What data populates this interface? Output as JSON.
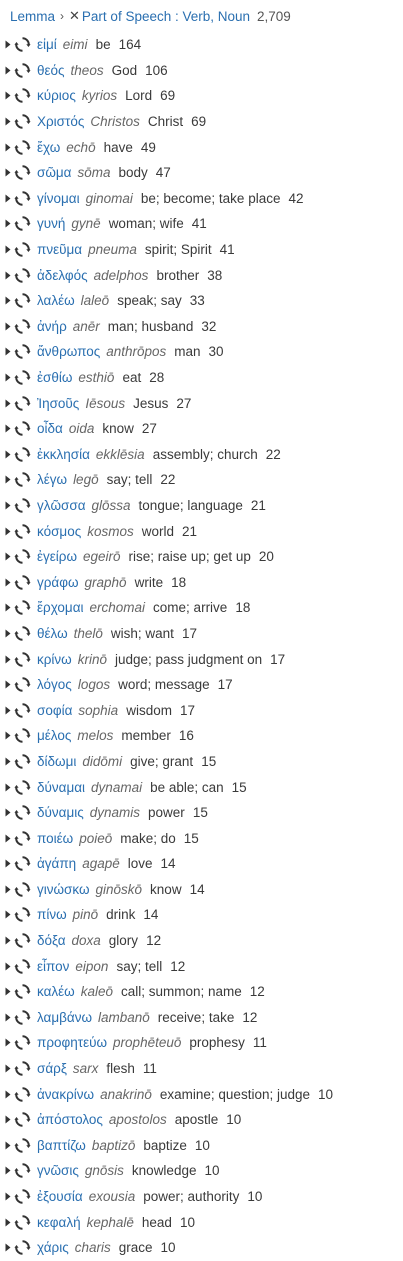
{
  "breadcrumb": {
    "root": "Lemma",
    "separator": "›",
    "clear_icon": "close-icon",
    "filter": "Part of Speech : Verb, Noun",
    "total": "2,709"
  },
  "colors": {
    "link": "#2a6fb0",
    "text": "#3a3a3a",
    "translit": "#666666"
  },
  "icons": {
    "expand": "triangle-right-icon",
    "cycle": "cycle-arrows-icon"
  },
  "rows": [
    {
      "greek": "εἰμί",
      "translit": "eimi",
      "gloss": "be",
      "count": "164"
    },
    {
      "greek": "θεός",
      "translit": "theos",
      "gloss": "God",
      "count": "106"
    },
    {
      "greek": "κύριος",
      "translit": "kyrios",
      "gloss": "Lord",
      "count": "69"
    },
    {
      "greek": "Χριστός",
      "translit": "Christos",
      "gloss": "Christ",
      "count": "69"
    },
    {
      "greek": "ἔχω",
      "translit": "echō",
      "gloss": "have",
      "count": "49"
    },
    {
      "greek": "σῶμα",
      "translit": "sōma",
      "gloss": "body",
      "count": "47"
    },
    {
      "greek": "γίνομαι",
      "translit": "ginomai",
      "gloss": "be; become; take place",
      "count": "42"
    },
    {
      "greek": "γυνή",
      "translit": "gynē",
      "gloss": "woman; wife",
      "count": "41"
    },
    {
      "greek": "πνεῦμα",
      "translit": "pneuma",
      "gloss": "spirit; Spirit",
      "count": "41"
    },
    {
      "greek": "ἀδελφός",
      "translit": "adelphos",
      "gloss": "brother",
      "count": "38"
    },
    {
      "greek": "λαλέω",
      "translit": "laleō",
      "gloss": "speak; say",
      "count": "33"
    },
    {
      "greek": "ἀνήρ",
      "translit": "anēr",
      "gloss": "man; husband",
      "count": "32"
    },
    {
      "greek": "ἄνθρωπος",
      "translit": "anthrōpos",
      "gloss": "man",
      "count": "30"
    },
    {
      "greek": "ἐσθίω",
      "translit": "esthiō",
      "gloss": "eat",
      "count": "28"
    },
    {
      "greek": "Ἰησοῦς",
      "translit": "Iēsous",
      "gloss": "Jesus",
      "count": "27"
    },
    {
      "greek": "οἶδα",
      "translit": "oida",
      "gloss": "know",
      "count": "27"
    },
    {
      "greek": "ἐκκλησία",
      "translit": "ekklēsia",
      "gloss": "assembly; church",
      "count": "22"
    },
    {
      "greek": "λέγω",
      "translit": "legō",
      "gloss": "say; tell",
      "count": "22"
    },
    {
      "greek": "γλῶσσα",
      "translit": "glōssa",
      "gloss": "tongue; language",
      "count": "21"
    },
    {
      "greek": "κόσμος",
      "translit": "kosmos",
      "gloss": "world",
      "count": "21"
    },
    {
      "greek": "ἐγείρω",
      "translit": "egeirō",
      "gloss": "rise; raise up; get up",
      "count": "20"
    },
    {
      "greek": "γράφω",
      "translit": "graphō",
      "gloss": "write",
      "count": "18"
    },
    {
      "greek": "ἔρχομαι",
      "translit": "erchomai",
      "gloss": "come; arrive",
      "count": "18"
    },
    {
      "greek": "θέλω",
      "translit": "thelō",
      "gloss": "wish; want",
      "count": "17"
    },
    {
      "greek": "κρίνω",
      "translit": "krinō",
      "gloss": "judge; pass judgment on",
      "count": "17"
    },
    {
      "greek": "λόγος",
      "translit": "logos",
      "gloss": "word; message",
      "count": "17"
    },
    {
      "greek": "σοφία",
      "translit": "sophia",
      "gloss": "wisdom",
      "count": "17"
    },
    {
      "greek": "μέλος",
      "translit": "melos",
      "gloss": "member",
      "count": "16"
    },
    {
      "greek": "δίδωμι",
      "translit": "didōmi",
      "gloss": "give; grant",
      "count": "15"
    },
    {
      "greek": "δύναμαι",
      "translit": "dynamai",
      "gloss": "be able; can",
      "count": "15"
    },
    {
      "greek": "δύναμις",
      "translit": "dynamis",
      "gloss": "power",
      "count": "15"
    },
    {
      "greek": "ποιέω",
      "translit": "poieō",
      "gloss": "make; do",
      "count": "15"
    },
    {
      "greek": "ἀγάπη",
      "translit": "agapē",
      "gloss": "love",
      "count": "14"
    },
    {
      "greek": "γινώσκω",
      "translit": "ginōskō",
      "gloss": "know",
      "count": "14"
    },
    {
      "greek": "πίνω",
      "translit": "pinō",
      "gloss": "drink",
      "count": "14"
    },
    {
      "greek": "δόξα",
      "translit": "doxa",
      "gloss": "glory",
      "count": "12"
    },
    {
      "greek": "εἶπον",
      "translit": "eipon",
      "gloss": "say; tell",
      "count": "12"
    },
    {
      "greek": "καλέω",
      "translit": "kaleō",
      "gloss": "call; summon; name",
      "count": "12"
    },
    {
      "greek": "λαμβάνω",
      "translit": "lambanō",
      "gloss": "receive; take",
      "count": "12"
    },
    {
      "greek": "προφητεύω",
      "translit": "prophēteuō",
      "gloss": "prophesy",
      "count": "11"
    },
    {
      "greek": "σάρξ",
      "translit": "sarx",
      "gloss": "flesh",
      "count": "11"
    },
    {
      "greek": "ἀνακρίνω",
      "translit": "anakrinō",
      "gloss": "examine; question; judge",
      "count": "10"
    },
    {
      "greek": "ἀπόστολος",
      "translit": "apostolos",
      "gloss": "apostle",
      "count": "10"
    },
    {
      "greek": "βαπτίζω",
      "translit": "baptizō",
      "gloss": "baptize",
      "count": "10"
    },
    {
      "greek": "γνῶσις",
      "translit": "gnōsis",
      "gloss": "knowledge",
      "count": "10"
    },
    {
      "greek": "ἐξουσία",
      "translit": "exousia",
      "gloss": "power; authority",
      "count": "10"
    },
    {
      "greek": "κεφαλή",
      "translit": "kephalē",
      "gloss": "head",
      "count": "10"
    },
    {
      "greek": "χάρις",
      "translit": "charis",
      "gloss": "grace",
      "count": "10"
    }
  ]
}
